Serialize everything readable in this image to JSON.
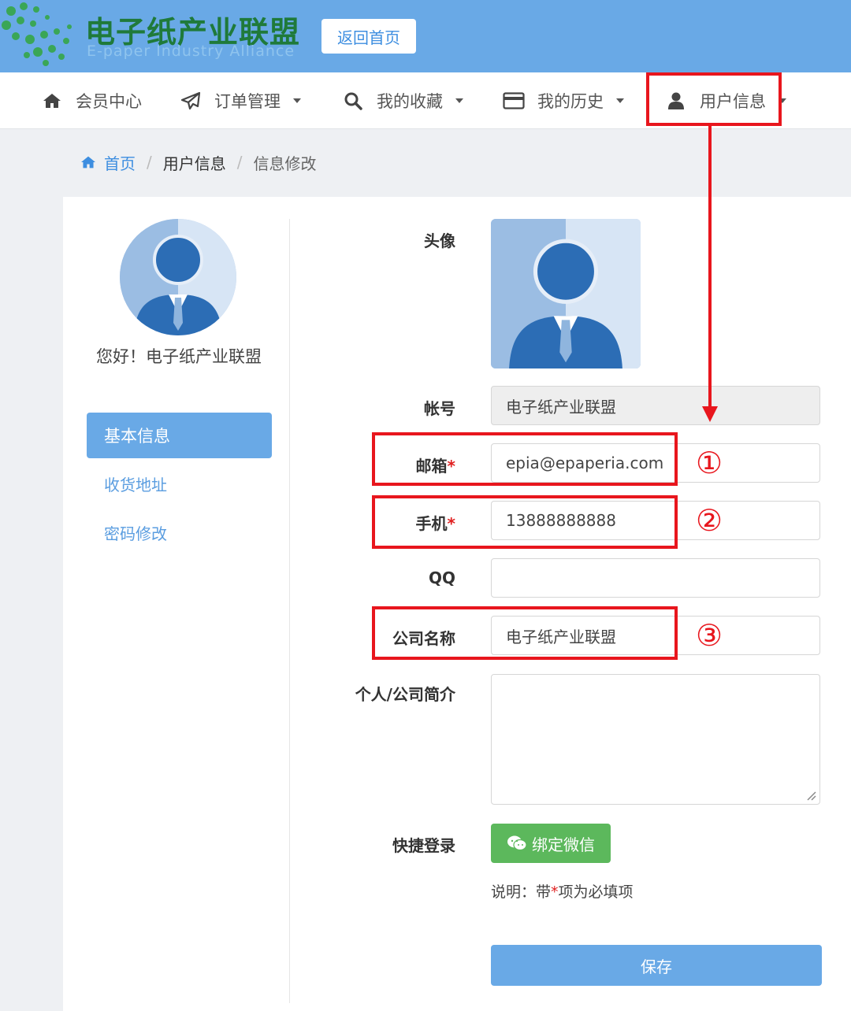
{
  "header": {
    "logo_title": "电子纸产业联盟",
    "logo_subtitle": "E-paper Industry Alliance",
    "back_button": "返回首页"
  },
  "nav": {
    "items": [
      {
        "label": "会员中心",
        "icon": "home-icon",
        "dropdown": false
      },
      {
        "label": "订单管理",
        "icon": "paper-plane-icon",
        "dropdown": true
      },
      {
        "label": "我的收藏",
        "icon": "search-icon",
        "dropdown": true
      },
      {
        "label": "我的历史",
        "icon": "credit-card-icon",
        "dropdown": true
      },
      {
        "label": "用户信息",
        "icon": "user-icon",
        "dropdown": true
      }
    ]
  },
  "breadcrumb": {
    "home": "首页",
    "level1": "用户信息",
    "level2": "信息修改"
  },
  "sidebar": {
    "greeting": "您好！电子纸产业联盟",
    "items": [
      {
        "label": "基本信息",
        "active": true
      },
      {
        "label": "收货地址",
        "active": false
      },
      {
        "label": "密码修改",
        "active": false
      }
    ]
  },
  "form": {
    "avatar_label": "头像",
    "account_label": "帐号",
    "account_value": "电子纸产业联盟",
    "email_label": "邮箱",
    "email_value": "epia@epaperia.com",
    "phone_label": "手机",
    "phone_value": "13888888888",
    "qq_label": "QQ",
    "qq_value": "",
    "company_label": "公司名称",
    "company_value": "电子纸产业联盟",
    "intro_label": "个人/公司简介",
    "quick_login_label": "快捷登录",
    "wechat_button": "绑定微信",
    "note_prefix": "说明：带",
    "note_star": "*",
    "note_suffix": "项为必填项",
    "required_mark": "*",
    "save_button": "保存"
  },
  "annotations": {
    "markers": [
      "①",
      "②",
      "③"
    ],
    "color": "#e8161d"
  },
  "colors": {
    "header_bg": "#69a9e6",
    "accent": "#69a9e6",
    "logo_green": "#1f7a3a",
    "wechat_green": "#5cb85c"
  }
}
